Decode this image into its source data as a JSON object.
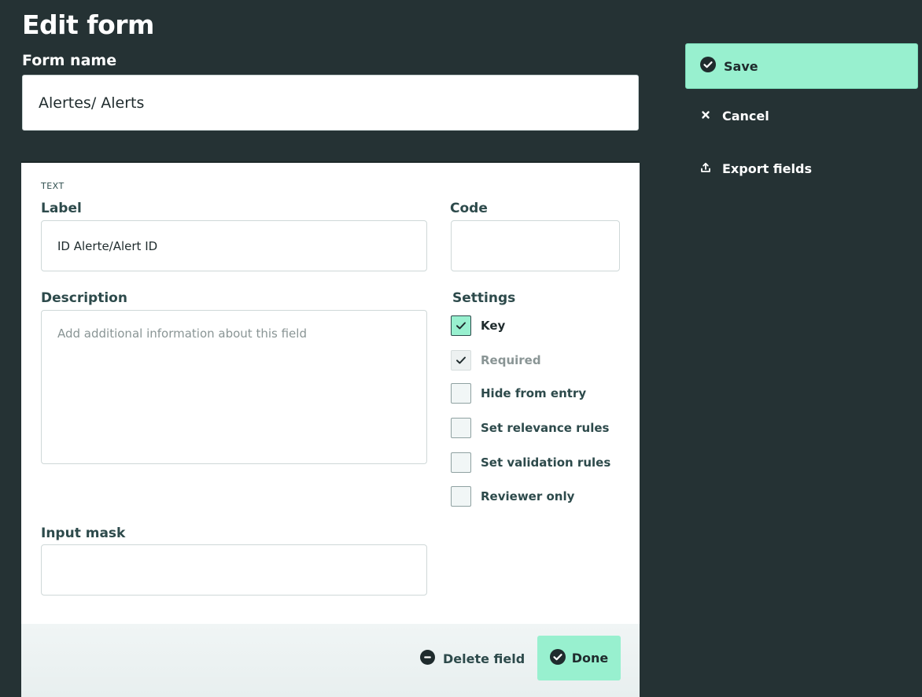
{
  "page": {
    "title": "Edit form",
    "form_name_label": "Form name",
    "form_name_value": "Alertes/ Alerts"
  },
  "actions": {
    "save": "Save",
    "cancel": "Cancel",
    "export": "Export fields"
  },
  "field": {
    "type_tag": "TEXT",
    "label_label": "Label",
    "label_value": "ID Alerte/Alert ID",
    "code_label": "Code",
    "code_value": "",
    "description_label": "Description",
    "description_placeholder": "Add additional information about this field",
    "input_mask_label": "Input mask",
    "input_mask_value": "",
    "settings_label": "Settings",
    "settings": [
      {
        "label": "Key",
        "checked": true,
        "disabled": false
      },
      {
        "label": "Required",
        "checked": true,
        "disabled": true
      },
      {
        "label": "Hide from entry",
        "checked": false,
        "disabled": false
      },
      {
        "label": "Set relevance rules",
        "checked": false,
        "disabled": false
      },
      {
        "label": "Set validation rules",
        "checked": false,
        "disabled": false
      },
      {
        "label": "Reviewer only",
        "checked": false,
        "disabled": false
      }
    ],
    "delete_label": "Delete field",
    "done_label": "Done"
  },
  "colors": {
    "background": "#253234",
    "accent": "#98f0cf",
    "text_dark": "#1f2b2d",
    "label": "#2d4a4b"
  },
  "icons": {
    "save": "check-circle-icon",
    "cancel": "close-icon",
    "export": "export-icon",
    "delete": "minus-circle-icon",
    "done": "check-circle-icon"
  }
}
